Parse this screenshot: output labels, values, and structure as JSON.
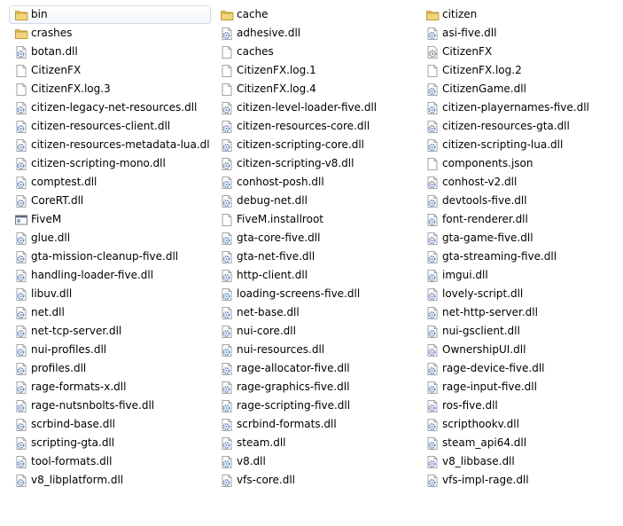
{
  "colors": {
    "selection_border": "#d4dbe6",
    "folder_yellow": "#e8c158",
    "dll_gear_blue": "#5b82b8"
  },
  "columns": [
    {
      "items": [
        {
          "name": "bin",
          "icon": "folder-icon",
          "selected": true
        },
        {
          "name": "crashes",
          "icon": "folder-icon"
        },
        {
          "name": "botan.dll",
          "icon": "dll-file-icon"
        },
        {
          "name": "CitizenFX",
          "icon": "file-icon"
        },
        {
          "name": "CitizenFX.log.3",
          "icon": "file-icon"
        },
        {
          "name": "citizen-legacy-net-resources.dll",
          "icon": "dll-file-icon"
        },
        {
          "name": "citizen-resources-client.dll",
          "icon": "dll-file-icon"
        },
        {
          "name": "citizen-resources-metadata-lua.dll",
          "icon": "dll-file-icon"
        },
        {
          "name": "citizen-scripting-mono.dll",
          "icon": "dll-file-icon"
        },
        {
          "name": "comptest.dll",
          "icon": "dll-file-icon"
        },
        {
          "name": "CoreRT.dll",
          "icon": "dll-file-icon"
        },
        {
          "name": "FiveM",
          "icon": "application-icon"
        },
        {
          "name": "glue.dll",
          "icon": "dll-file-icon"
        },
        {
          "name": "gta-mission-cleanup-five.dll",
          "icon": "dll-file-icon"
        },
        {
          "name": "handling-loader-five.dll",
          "icon": "dll-file-icon"
        },
        {
          "name": "libuv.dll",
          "icon": "dll-file-icon"
        },
        {
          "name": "net.dll",
          "icon": "dll-file-icon"
        },
        {
          "name": "net-tcp-server.dll",
          "icon": "dll-file-icon"
        },
        {
          "name": "nui-profiles.dll",
          "icon": "dll-file-icon"
        },
        {
          "name": "profiles.dll",
          "icon": "dll-file-icon"
        },
        {
          "name": "rage-formats-x.dll",
          "icon": "dll-file-icon"
        },
        {
          "name": "rage-nutsnbolts-five.dll",
          "icon": "dll-file-icon"
        },
        {
          "name": "scrbind-base.dll",
          "icon": "dll-file-icon"
        },
        {
          "name": "scripting-gta.dll",
          "icon": "dll-file-icon"
        },
        {
          "name": "tool-formats.dll",
          "icon": "dll-file-icon"
        },
        {
          "name": "v8_libplatform.dll",
          "icon": "dll-file-icon"
        }
      ]
    },
    {
      "items": [
        {
          "name": "cache",
          "icon": "folder-icon"
        },
        {
          "name": "adhesive.dll",
          "icon": "dll-file-icon"
        },
        {
          "name": "caches",
          "icon": "file-icon"
        },
        {
          "name": "CitizenFX.log.1",
          "icon": "file-icon"
        },
        {
          "name": "CitizenFX.log.4",
          "icon": "file-icon"
        },
        {
          "name": "citizen-level-loader-five.dll",
          "icon": "dll-file-icon"
        },
        {
          "name": "citizen-resources-core.dll",
          "icon": "dll-file-icon"
        },
        {
          "name": "citizen-scripting-core.dll",
          "icon": "dll-file-icon"
        },
        {
          "name": "citizen-scripting-v8.dll",
          "icon": "dll-file-icon"
        },
        {
          "name": "conhost-posh.dll",
          "icon": "dll-file-icon"
        },
        {
          "name": "debug-net.dll",
          "icon": "dll-file-icon"
        },
        {
          "name": "FiveM.installroot",
          "icon": "file-icon"
        },
        {
          "name": "gta-core-five.dll",
          "icon": "dll-file-icon"
        },
        {
          "name": "gta-net-five.dll",
          "icon": "dll-file-icon"
        },
        {
          "name": "http-client.dll",
          "icon": "dll-file-icon"
        },
        {
          "name": "loading-screens-five.dll",
          "icon": "dll-file-icon"
        },
        {
          "name": "net-base.dll",
          "icon": "dll-file-icon"
        },
        {
          "name": "nui-core.dll",
          "icon": "dll-file-icon"
        },
        {
          "name": "nui-resources.dll",
          "icon": "dll-file-icon"
        },
        {
          "name": "rage-allocator-five.dll",
          "icon": "dll-file-icon"
        },
        {
          "name": "rage-graphics-five.dll",
          "icon": "dll-file-icon"
        },
        {
          "name": "rage-scripting-five.dll",
          "icon": "dll-file-icon"
        },
        {
          "name": "scrbind-formats.dll",
          "icon": "dll-file-icon"
        },
        {
          "name": "steam.dll",
          "icon": "dll-file-icon"
        },
        {
          "name": "v8.dll",
          "icon": "dll-file-icon"
        },
        {
          "name": "vfs-core.dll",
          "icon": "dll-file-icon"
        }
      ]
    },
    {
      "items": [
        {
          "name": "citizen",
          "icon": "folder-icon"
        },
        {
          "name": "asi-five.dll",
          "icon": "dll-file-icon"
        },
        {
          "name": "CitizenFX",
          "icon": "settings-file-icon"
        },
        {
          "name": "CitizenFX.log.2",
          "icon": "file-icon"
        },
        {
          "name": "CitizenGame.dll",
          "icon": "dll-file-icon"
        },
        {
          "name": "citizen-playernames-five.dll",
          "icon": "dll-file-icon"
        },
        {
          "name": "citizen-resources-gta.dll",
          "icon": "dll-file-icon"
        },
        {
          "name": "citizen-scripting-lua.dll",
          "icon": "dll-file-icon"
        },
        {
          "name": "components.json",
          "icon": "file-icon"
        },
        {
          "name": "conhost-v2.dll",
          "icon": "dll-file-icon"
        },
        {
          "name": "devtools-five.dll",
          "icon": "dll-file-icon"
        },
        {
          "name": "font-renderer.dll",
          "icon": "dll-file-icon"
        },
        {
          "name": "gta-game-five.dll",
          "icon": "dll-file-icon"
        },
        {
          "name": "gta-streaming-five.dll",
          "icon": "dll-file-icon"
        },
        {
          "name": "imgui.dll",
          "icon": "dll-file-icon"
        },
        {
          "name": "lovely-script.dll",
          "icon": "dll-file-icon"
        },
        {
          "name": "net-http-server.dll",
          "icon": "dll-file-icon"
        },
        {
          "name": "nui-gsclient.dll",
          "icon": "dll-file-icon"
        },
        {
          "name": "OwnershipUI.dll",
          "icon": "dll-file-icon"
        },
        {
          "name": "rage-device-five.dll",
          "icon": "dll-file-icon"
        },
        {
          "name": "rage-input-five.dll",
          "icon": "dll-file-icon"
        },
        {
          "name": "ros-five.dll",
          "icon": "dll-file-icon"
        },
        {
          "name": "scripthookv.dll",
          "icon": "dll-file-icon"
        },
        {
          "name": "steam_api64.dll",
          "icon": "dll-file-icon"
        },
        {
          "name": "v8_libbase.dll",
          "icon": "dll-file-icon"
        },
        {
          "name": "vfs-impl-rage.dll",
          "icon": "dll-file-icon"
        }
      ]
    }
  ]
}
